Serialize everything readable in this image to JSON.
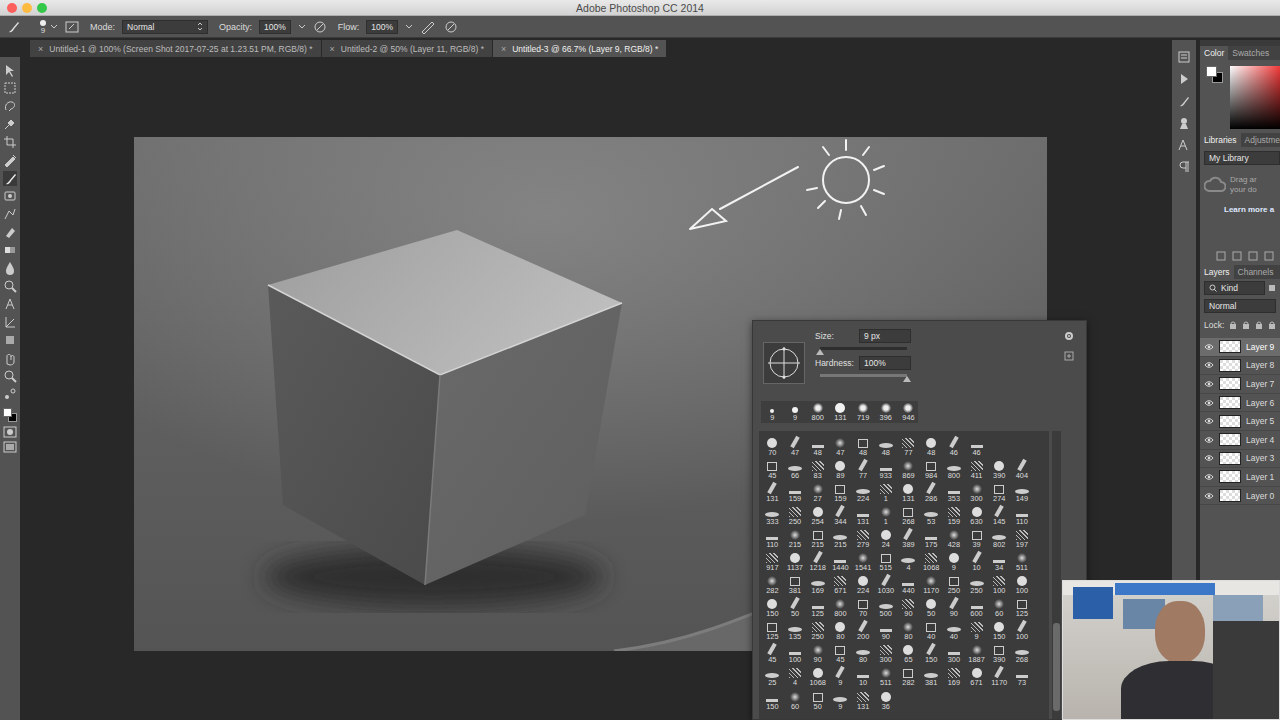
{
  "window": {
    "title": "Adobe Photoshop CC 2014"
  },
  "options_bar": {
    "brush_size": "9",
    "mode_label": "Mode:",
    "mode": "Normal",
    "opacity_label": "Opacity:",
    "opacity": "100%",
    "flow_label": "Flow:",
    "flow": "100%"
  },
  "tabs": [
    {
      "label": "Untitled-1 @ 100% (Screen Shot 2017-07-25 at 1.23.51 PM, RGB/8) *",
      "close": "×",
      "selected": false
    },
    {
      "label": "Untitled-2 @ 50% (Layer 11, RGB/8) *",
      "close": "×",
      "selected": false
    },
    {
      "label": "Untitled-3 @ 66.7% (Layer 9, RGB/8) *",
      "close": "×",
      "selected": true
    }
  ],
  "brush_picker": {
    "size_label": "Size:",
    "size": "9 px",
    "size_level": 0.0,
    "hardness_label": "Hardness:",
    "hardness": "100%",
    "hardness_level": 1.0,
    "recent": [
      {
        "size": "9",
        "kind": "hard"
      },
      {
        "size": "9",
        "kind": "hard"
      },
      {
        "size": "800",
        "kind": "soft"
      },
      {
        "size": "131",
        "kind": "hard"
      },
      {
        "size": "719",
        "kind": "soft"
      },
      {
        "size": "396",
        "kind": "soft"
      },
      {
        "size": "946",
        "kind": "soft"
      }
    ],
    "presets": [
      [
        "70",
        "47",
        "48",
        "47",
        "48",
        "48",
        "77",
        "48",
        "46",
        "46"
      ],
      [
        "45",
        "66",
        "83",
        "89",
        "77",
        "933",
        "869",
        "984",
        "800",
        "411",
        "390",
        "404"
      ],
      [
        "131",
        "159",
        "27",
        "159",
        "224",
        "1",
        "131",
        "286",
        "353",
        "300",
        "274",
        "149"
      ],
      [
        "333",
        "250",
        "254",
        "344",
        "131",
        "1",
        "268",
        "53",
        "159",
        "630",
        "145",
        "110"
      ],
      [
        "110",
        "215",
        "215",
        "215",
        "279",
        "24",
        "389",
        "175",
        "428",
        "39",
        "802",
        "197"
      ],
      [
        "917",
        "1137",
        "1218",
        "1440",
        "1541",
        "515",
        "4",
        "1068",
        "9",
        "10",
        "34",
        "511"
      ],
      [
        "282",
        "381",
        "169",
        "671",
        "224",
        "1030",
        "440",
        "1170",
        "250",
        "250",
        "100",
        "100"
      ],
      [
        "150",
        "50",
        "125",
        "800",
        "70",
        "500",
        "90",
        "50",
        "90",
        "600",
        "60",
        "125"
      ],
      [
        "125",
        "135",
        "250",
        "80",
        "200",
        "90",
        "80",
        "40",
        "40",
        "9",
        "150",
        "100"
      ],
      [
        "45",
        "100",
        "90",
        "45",
        "80",
        "300",
        "65",
        "150",
        "300",
        "1887",
        "390",
        "268"
      ],
      [
        "25",
        "4",
        "1068",
        "9",
        "10",
        "511",
        "282",
        "381",
        "169",
        "671",
        "1170",
        "73"
      ],
      [
        "150",
        "60",
        "50",
        "9",
        "131",
        "36"
      ]
    ]
  },
  "color_panel": {
    "tabs": [
      {
        "label": "Color",
        "selected": true
      },
      {
        "label": "Swatches",
        "selected": false
      }
    ]
  },
  "libraries_panel": {
    "tabs": [
      {
        "label": "Libraries",
        "selected": true
      },
      {
        "label": "Adjustme",
        "selected": false
      }
    ],
    "library": "My Library",
    "hint": [
      "Drag ar",
      "your do"
    ],
    "link": "Learn more a"
  },
  "layers_panel": {
    "tabs": [
      {
        "label": "Layers",
        "selected": true
      },
      {
        "label": "Channels",
        "selected": false
      }
    ],
    "filter": "Kind",
    "blend_mode": "Normal",
    "lock_label": "Lock:",
    "layers": [
      {
        "name": "Layer 9",
        "visible": true,
        "selected": true
      },
      {
        "name": "Layer 8",
        "visible": true,
        "selected": false
      },
      {
        "name": "Layer 7",
        "visible": true,
        "selected": false
      },
      {
        "name": "Layer 6",
        "visible": true,
        "selected": false
      },
      {
        "name": "Layer 5",
        "visible": true,
        "selected": false
      },
      {
        "name": "Layer 4",
        "visible": true,
        "selected": false
      },
      {
        "name": "Layer 3",
        "visible": true,
        "selected": false
      },
      {
        "name": "Layer 1",
        "visible": true,
        "selected": false
      },
      {
        "name": "Layer 0",
        "visible": true,
        "selected": false
      }
    ]
  }
}
